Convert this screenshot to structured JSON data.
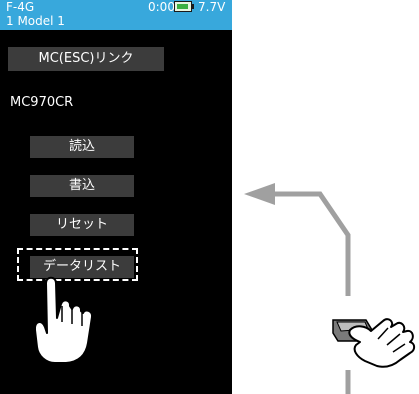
{
  "status_bar": {
    "model_number": "F-4G",
    "model_name": "1   Model 1",
    "timer": "0:00",
    "battery_voltage": "7.7V",
    "battery_icon": "battery-icon"
  },
  "screen": {
    "title": "MC(ESC)リンク",
    "device_name": "MC970CR",
    "buttons": {
      "load": "読込",
      "write": "書込",
      "reset": "リセット",
      "data_list": "データリスト"
    }
  },
  "annotations": {
    "tap_icon": "hand-pointer-icon",
    "arrow_icon": "arrow-left-icon",
    "key_press_icon": "hand-press-key-icon"
  },
  "colors": {
    "header": "#38a8dc",
    "button_bg": "#3c3c3c",
    "screen_bg": "#000000",
    "annotation_line": "#a0a0a0"
  }
}
